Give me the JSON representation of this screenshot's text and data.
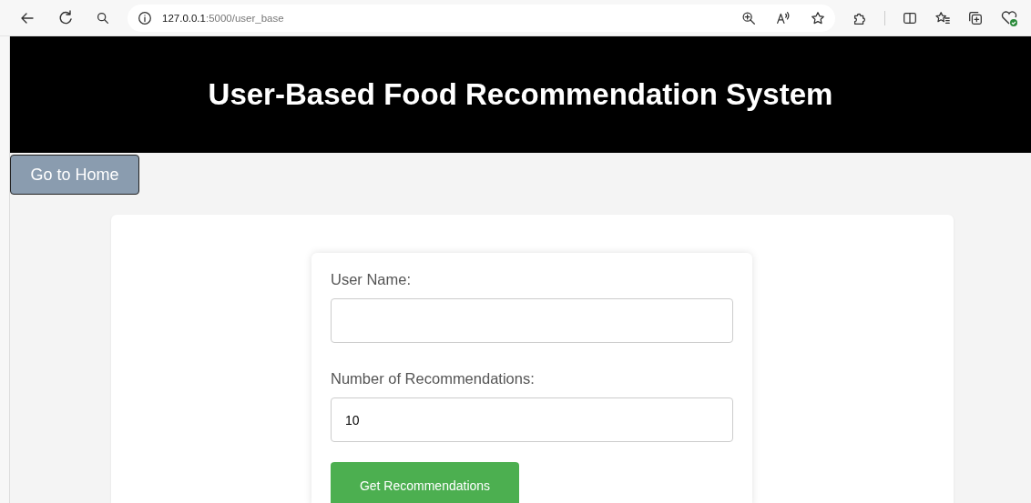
{
  "browser": {
    "url": {
      "host": "127.0.0.1",
      "path": ":5000/user_base"
    }
  },
  "header": {
    "title": "User-Based Food Recommendation System"
  },
  "home_button": {
    "label": "Go to Home"
  },
  "form": {
    "fields": [
      {
        "label": "User Name:"
      },
      {
        "label": "Number of Recommendations:",
        "value": "10"
      }
    ],
    "submit": {
      "label": "Get Recommendations"
    }
  }
}
